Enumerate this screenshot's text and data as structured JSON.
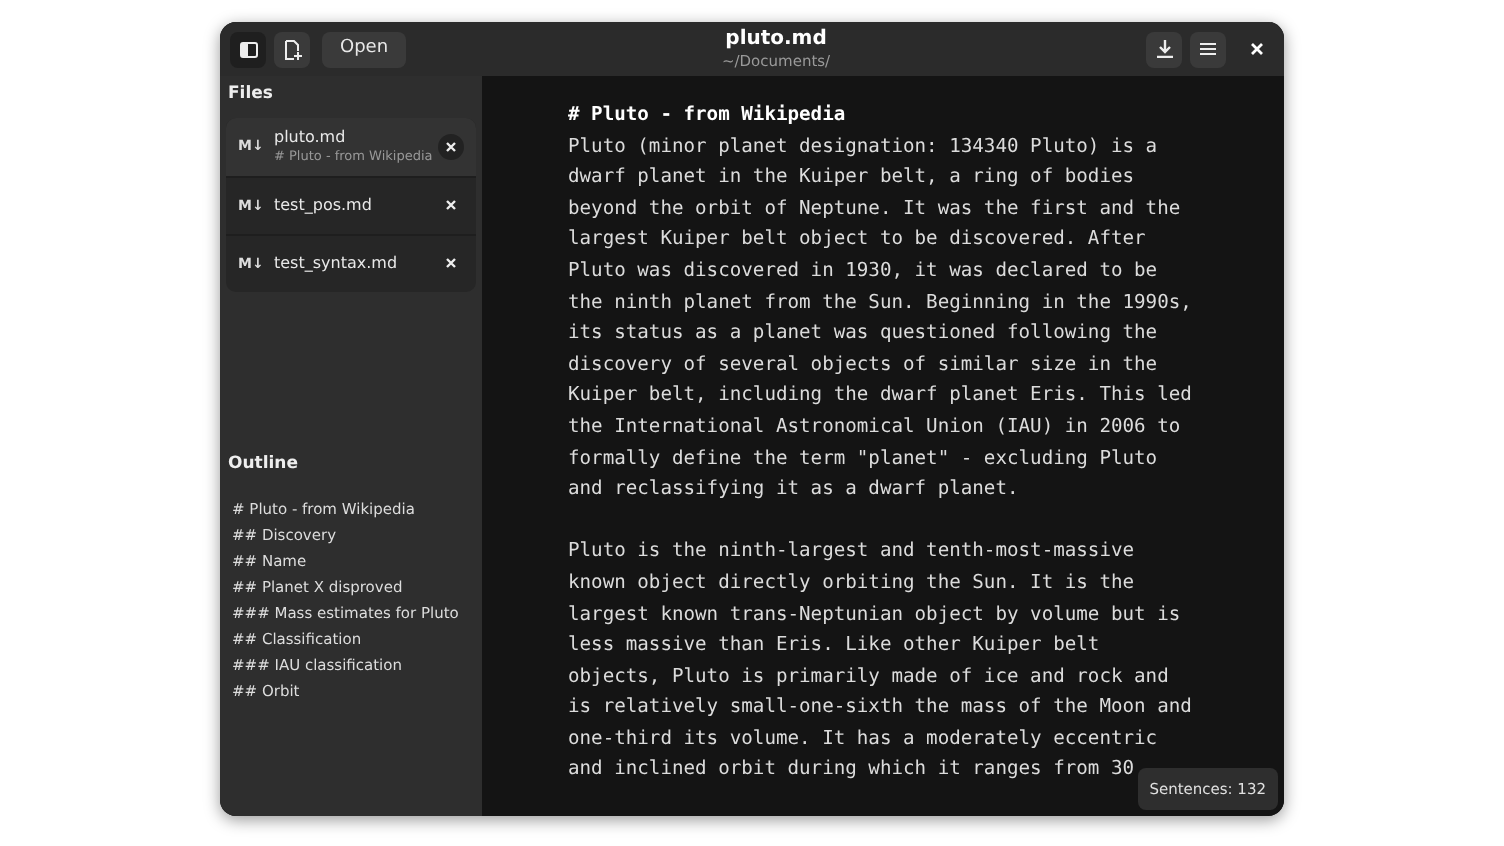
{
  "window": {
    "title": "pluto.md",
    "subtitle": "~/Documents/"
  },
  "toolbar": {
    "open_button": "Open"
  },
  "sidebar": {
    "files_title": "Files",
    "files": [
      {
        "badge": "M↓",
        "name": "pluto.md",
        "heading": "# Pluto - from Wikipedia",
        "selected": true
      },
      {
        "badge": "M↓",
        "name": "test_pos.md",
        "selected": false
      },
      {
        "badge": "M↓",
        "name": "test_syntax.md",
        "selected": false
      }
    ],
    "outline_title": "Outline",
    "outline": [
      "# Pluto - from Wikipedia",
      "## Discovery",
      "## Name",
      "## Planet X disproved",
      "### Mass estimates for Pluto",
      "## Classification",
      "### IAU classification",
      "## Orbit"
    ]
  },
  "editor": {
    "heading": "# Pluto - from Wikipedia",
    "paragraphs": [
      [
        "Pluto (minor planet designation: 134340 Pluto) is a",
        "dwarf planet in the Kuiper belt, a ring of bodies",
        "beyond the orbit of Neptune. It was the first and the",
        "largest Kuiper belt object to be discovered. After",
        "Pluto was discovered in 1930, it was declared to be",
        "the ninth planet from the Sun. Beginning in the 1990s,",
        "its status as a planet was questioned following the",
        "discovery of several objects of similar size in the",
        "Kuiper belt, including the dwarf planet Eris. This led",
        "the International Astronomical Union (IAU) in 2006 to",
        "formally define the term \"planet\" - excluding Pluto",
        "and reclassifying it as a dwarf planet."
      ],
      [
        "Pluto is the ninth-largest and tenth-most-massive",
        "known object directly orbiting the Sun. It is the",
        "largest known trans-Neptunian object by volume but is",
        "less massive than Eris. Like other Kuiper belt",
        "objects, Pluto is primarily made of ice and rock and",
        "is relatively small-one-sixth the mass of the Moon and",
        "one-third its volume. It has a moderately eccentric",
        "and inclined orbit during which it ranges from 30"
      ]
    ]
  },
  "status": {
    "sentences": "Sentences: 132"
  }
}
